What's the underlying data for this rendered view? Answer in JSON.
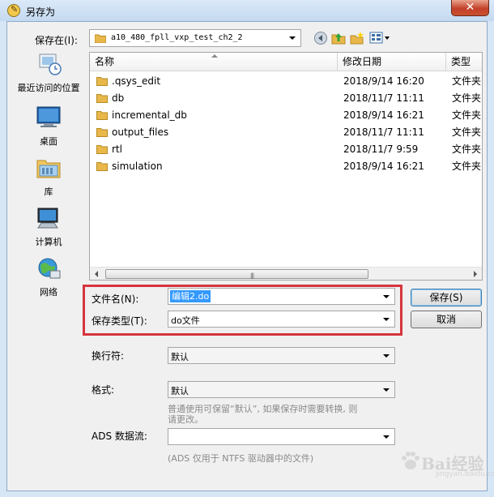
{
  "window": {
    "title": "另存为",
    "close_glyph": "✕"
  },
  "save_in": {
    "label": "保存在(I):",
    "path": "a10_480_fpll_vxp_test_ch2_2"
  },
  "toolbar_icons": [
    "back-icon",
    "up-folder-icon",
    "new-folder-icon",
    "view-menu-icon"
  ],
  "places": [
    {
      "id": "recent",
      "label": "最近访问的位置",
      "icon": "recent-places-icon"
    },
    {
      "id": "desktop",
      "label": "桌面",
      "icon": "desktop-icon"
    },
    {
      "id": "library",
      "label": "库",
      "icon": "library-icon"
    },
    {
      "id": "computer",
      "label": "计算机",
      "icon": "computer-icon"
    },
    {
      "id": "network",
      "label": "网络",
      "icon": "network-icon"
    }
  ],
  "columns": [
    "名称",
    "修改日期",
    "类型"
  ],
  "files": [
    {
      "name": ".qsys_edit",
      "date": "2018/9/14 16:20",
      "type": "文件夹"
    },
    {
      "name": "db",
      "date": "2018/11/7 11:11",
      "type": "文件夹"
    },
    {
      "name": "incremental_db",
      "date": "2018/9/14 16:21",
      "type": "文件夹"
    },
    {
      "name": "output_files",
      "date": "2018/11/7 11:11",
      "type": "文件夹"
    },
    {
      "name": "rtl",
      "date": "2018/11/7 9:59",
      "type": "文件夹"
    },
    {
      "name": "simulation",
      "date": "2018/9/14 16:21",
      "type": "文件夹"
    }
  ],
  "fields": {
    "filename_label": "文件名(N):",
    "filename_value": "编辑2.do",
    "filetype_label": "保存类型(T):",
    "filetype_value": "do文件",
    "linebreak_label": "换行符:",
    "linebreak_value": "默认",
    "format_label": "格式:",
    "format_value": "默认",
    "format_hint_1": "普通使用可保留“默认”, 如果保存时需要转换, 则",
    "format_hint_2": "请更改。",
    "ads_label": "ADS 数据流:",
    "ads_value": "",
    "ads_hint": "(ADS 仅用于 NTFS 驱动器中的文件)"
  },
  "buttons": {
    "save": "保存(S)",
    "cancel": "取消"
  },
  "watermark": {
    "text": "Bai经验",
    "sub": "jingyan.baidu.com"
  },
  "colors": {
    "highlight_box": "#d7353d",
    "selection": "#3399ff",
    "folder": "#e8b84a"
  }
}
